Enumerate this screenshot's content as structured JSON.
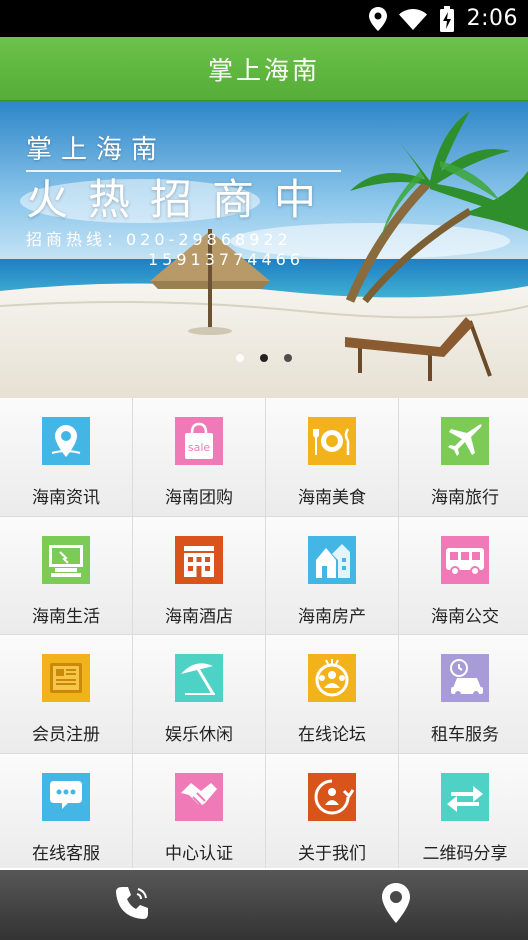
{
  "status_bar": {
    "time": "2:06",
    "icons": [
      "location-icon",
      "wifi-icon",
      "battery-icon"
    ]
  },
  "header": {
    "title": "掌上海南"
  },
  "banner": {
    "brand": "掌上海南",
    "slogan": "火热招商中",
    "hotline_line1": "招商热线：020-29868922",
    "hotline_line2": "15913774466",
    "slide_count": 3,
    "active_slide": 2
  },
  "grid": [
    {
      "label": "海南资讯",
      "icon": "map-pin-icon",
      "color": "#43b6e6"
    },
    {
      "label": "海南团购",
      "icon": "sale-bag-icon",
      "color": "#f07ab8",
      "icon_text": "sale"
    },
    {
      "label": "海南美食",
      "icon": "plate-cutlery-icon",
      "color": "#f2b21c"
    },
    {
      "label": "海南旅行",
      "icon": "airplane-icon",
      "color": "#7ccb57"
    },
    {
      "label": "海南生活",
      "icon": "computer-icon",
      "color": "#7ccb57"
    },
    {
      "label": "海南酒店",
      "icon": "hotel-icon",
      "color": "#d9541b"
    },
    {
      "label": "海南房产",
      "icon": "house-icon",
      "color": "#43b6e6"
    },
    {
      "label": "海南公交",
      "icon": "bus-icon",
      "color": "#f07ab8"
    },
    {
      "label": "会员注册",
      "icon": "newspaper-icon",
      "color": "#f2b21c"
    },
    {
      "label": "娱乐休闲",
      "icon": "umbrella-icon",
      "color": "#4fd2c6"
    },
    {
      "label": "在线论坛",
      "icon": "forum-icon",
      "color": "#f2b21c"
    },
    {
      "label": "租车服务",
      "icon": "car-rental-icon",
      "color": "#a79cd8"
    },
    {
      "label": "在线客服",
      "icon": "chat-icon",
      "color": "#43b6e6"
    },
    {
      "label": "中心认证",
      "icon": "handshake-icon",
      "color": "#f07ab8"
    },
    {
      "label": "关于我们",
      "icon": "about-us-icon",
      "color": "#d9541b"
    },
    {
      "label": "二维码分享",
      "icon": "share-arrows-icon",
      "color": "#4fd2c6"
    }
  ],
  "bottom_bar": {
    "buttons": [
      "phone-icon",
      "location-icon"
    ]
  }
}
